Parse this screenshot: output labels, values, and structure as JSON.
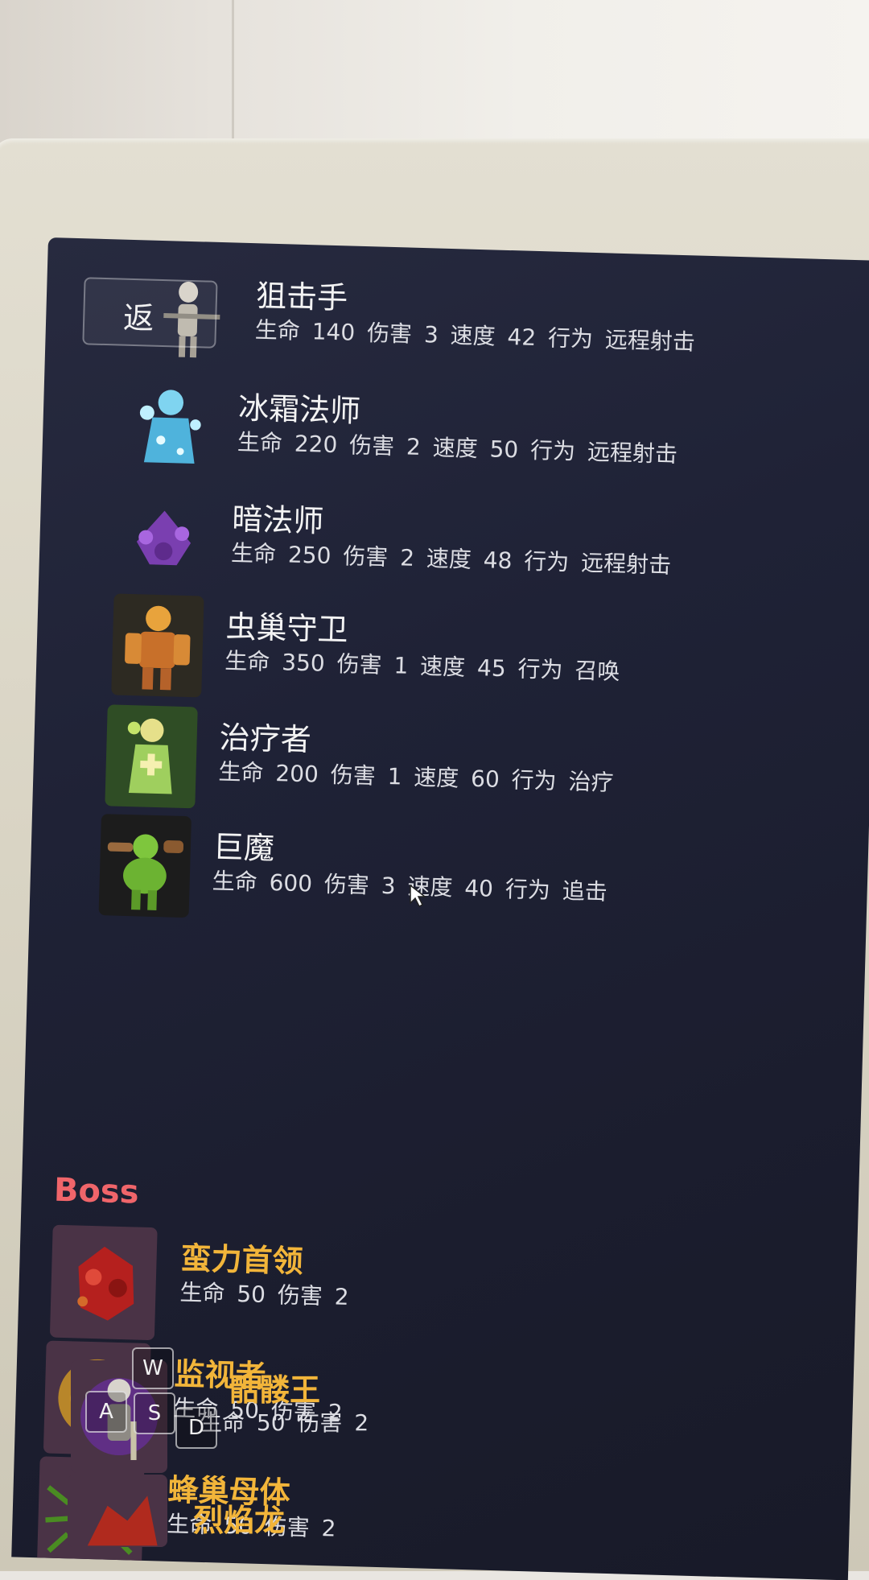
{
  "nav": {
    "back_label": "返"
  },
  "enemies": [
    {
      "name": "狙击手",
      "stats": "生命 140  伤害 3  速度 42  行为 远程射击",
      "icon": "sniper-icon"
    },
    {
      "name": "冰霜法师",
      "stats": "生命 220  伤害 2  速度 50  行为 远程射击",
      "icon": "frost-mage-icon"
    },
    {
      "name": "暗法师",
      "stats": "生命 250  伤害 2  速度 48  行为 远程射击",
      "icon": "dark-mage-icon"
    },
    {
      "name": "虫巢守卫",
      "stats": "生命 350  伤害 1  速度 45  行为 召唤",
      "icon": "hive-guard-icon"
    },
    {
      "name": "治疗者",
      "stats": "生命 200  伤害 1  速度 60  行为 治疗",
      "icon": "healer-icon"
    },
    {
      "name": "巨魔",
      "stats": "生命 600  伤害 3  速度 40  行为 追击",
      "icon": "troll-icon"
    }
  ],
  "boss_section": {
    "header": "Boss",
    "bosses": [
      {
        "name": "蛮力首领",
        "stats": "生命 50  伤害 2",
        "icon": "brute-boss-icon"
      },
      {
        "name": "监视者",
        "stats": "生命 50  伤害 2",
        "icon": "watcher-icon"
      },
      {
        "name": "蜂巢母体",
        "stats": "生命 50  伤害 2",
        "icon": "hive-mother-icon"
      },
      {
        "name": "骷髅王",
        "stats": "生命 50  伤害 2",
        "icon": "skeleton-king-icon"
      },
      {
        "name": "烈焰龙",
        "stats": "",
        "icon": "flame-dragon-icon"
      }
    ]
  },
  "keys": {
    "w": "W",
    "a": "A",
    "s": "S",
    "d": "D"
  }
}
